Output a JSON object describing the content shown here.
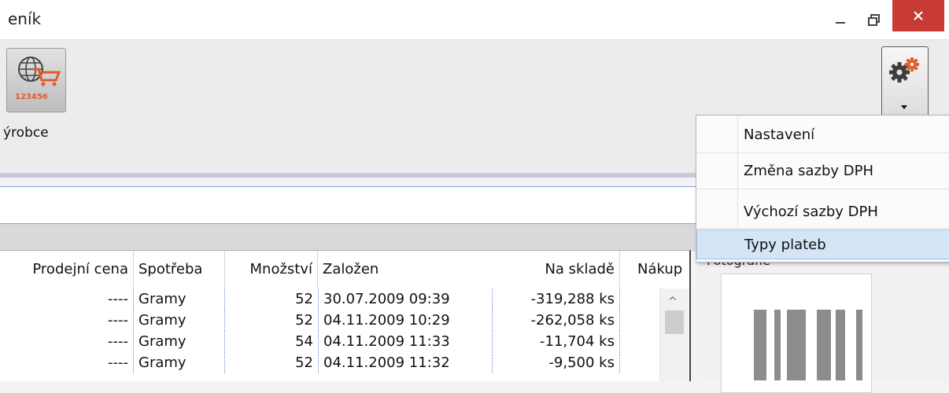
{
  "window": {
    "title": "eník"
  },
  "ribbon": {
    "button_label": "ýrobce"
  },
  "menu": {
    "items": [
      {
        "label": "Nastavení"
      },
      {
        "label": "Změna sazby DPH"
      },
      {
        "label": "Výchozí sazby DPH"
      },
      {
        "label": "Typy plateb"
      }
    ]
  },
  "grid": {
    "headers": [
      "Prodejní cena",
      "Spotřeba",
      "Množství",
      "Založen",
      "Na skladě",
      "Nákup"
    ],
    "rows": [
      {
        "price": "----",
        "unit": "Gramy",
        "qty": "52",
        "created": "30.07.2009 09:39",
        "stock": "-319,288 ks"
      },
      {
        "price": "----",
        "unit": "Gramy",
        "qty": "52",
        "created": "04.11.2009 10:29",
        "stock": "-262,058 ks"
      },
      {
        "price": "----",
        "unit": "Gramy",
        "qty": "54",
        "created": "04.11.2009 11:33",
        "stock": "-11,704 ks"
      },
      {
        "price": "----",
        "unit": "Gramy",
        "qty": "52",
        "created": "04.11.2009 11:32",
        "stock": "-9,500 ks"
      }
    ]
  },
  "photo_panel": {
    "label": "Fotografie"
  },
  "icons": {
    "ribbon_button": "globe-cart-icon",
    "settings": "gears-icon",
    "caret": "caret-down-icon"
  },
  "colors": {
    "close_button": "#c83a36",
    "menu_highlight": "#d5e5f6",
    "accent_line": "#7ea6d6"
  }
}
